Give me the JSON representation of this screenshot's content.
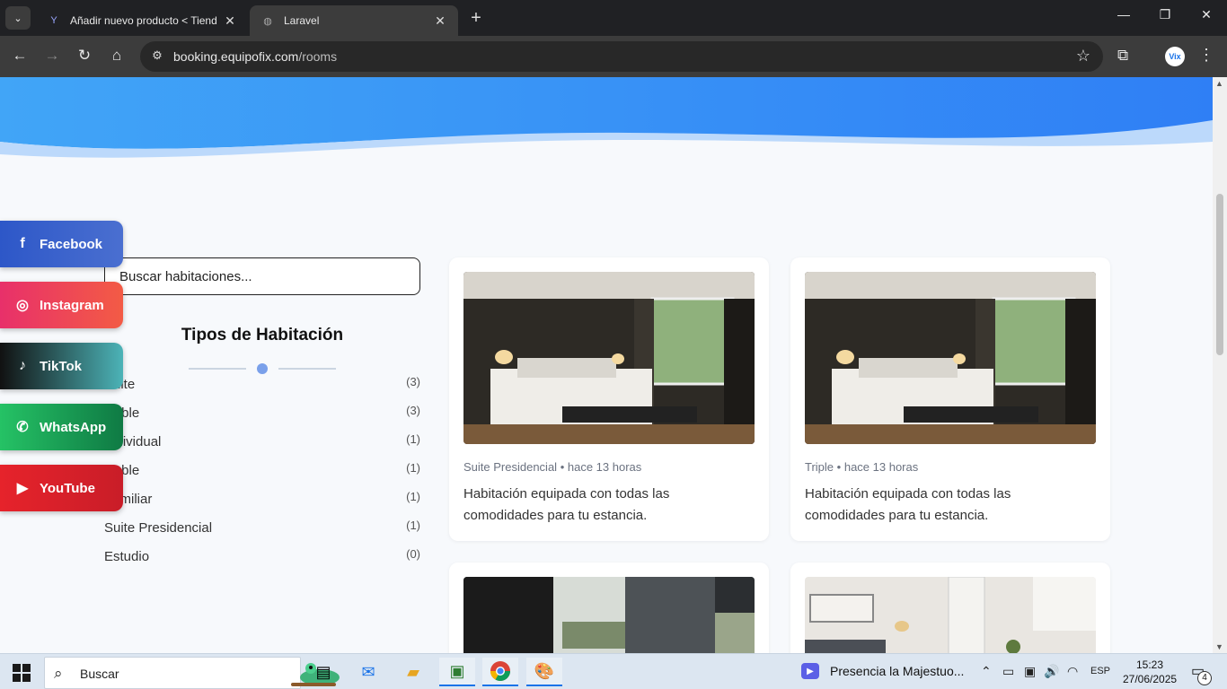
{
  "browser": {
    "tabs": [
      {
        "label": "Añadir nuevo producto < Tiend",
        "active": false
      },
      {
        "label": "Laravel",
        "active": true
      }
    ],
    "new_tab": "+",
    "url_host": "booking.equipofix.com",
    "url_path": "/rooms",
    "window_controls": [
      "—",
      "❐",
      "✕"
    ]
  },
  "sidebar": {
    "search_placeholder": "Buscar habitaciones...",
    "types_title": "Tipos de Habitación",
    "types": [
      {
        "label": "Suite",
        "count": "(3)"
      },
      {
        "label": "Doble",
        "count": "(3)"
      },
      {
        "label": "Individual",
        "count": "(1)"
      },
      {
        "label": "Doble",
        "count": "(1)"
      },
      {
        "label": "Familiar",
        "count": "(1)"
      },
      {
        "label": "Suite Presidencial",
        "count": "(1)"
      },
      {
        "label": "Estudio",
        "count": "(0)"
      }
    ]
  },
  "social": [
    {
      "label": "Facebook",
      "icon": "f",
      "color": "#3b5fc0"
    },
    {
      "label": "Instagram",
      "icon": "◎",
      "color": "#ee3b63"
    },
    {
      "label": "TikTok",
      "icon": "♪",
      "color": "#15282b"
    },
    {
      "label": "WhatsApp",
      "icon": "✆",
      "color": "#1ea55a"
    },
    {
      "label": "YouTube",
      "icon": "▶",
      "color": "#e0242a"
    }
  ],
  "rooms": [
    {
      "type": "Suite Presidencial",
      "time": "hace 13 horas",
      "separator": "•",
      "description": "Habitación equipada con todas las comodidades para tu estancia."
    },
    {
      "type": "Triple",
      "time": "hace 13 horas",
      "separator": "•",
      "description": "Habitación equipada con todas las comodidades para tu estancia."
    }
  ],
  "taskbar": {
    "search_label": "Buscar",
    "media_title": "Presencia la Majestuo...",
    "language": "ESP",
    "time": "15:23",
    "date": "27/06/2025",
    "notifications": "4"
  },
  "colors": {
    "hero_top": "#3d9bf6",
    "hero_bottom": "#2f7ff5",
    "accent_dot": "#7aa0ea"
  }
}
